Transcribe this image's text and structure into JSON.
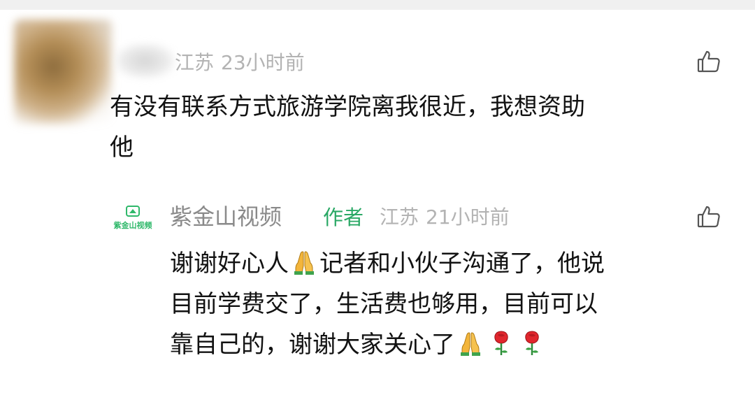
{
  "comment": {
    "location": "江苏",
    "time": "23小时前",
    "text_lines": [
      "有没有联系方式旅游学院离我很近，我想资助",
      "他"
    ]
  },
  "reply": {
    "avatar_text": "紫金山视频",
    "username": "紫金山视频",
    "badge": "作者",
    "location": "江苏",
    "time": "21小时前",
    "line1_before_emoji": "谢谢好心人",
    "line1_after_emoji": "记者和小伙子沟通了，他说",
    "line2": "目前学费交了，生活费也够用，目前可以",
    "line3": "靠自己的，谢谢大家关心了"
  },
  "icons": {
    "like": "thumbs-up-icon",
    "emoji_1": "folded-hands-icon",
    "emoji_2": "folded-hands-icon",
    "emoji_3": "rose-icon",
    "emoji_4": "rose-icon"
  },
  "colors": {
    "author_green": "#2aa865",
    "meta_gray": "#b3b3b3",
    "name_gray": "#8a8a8a"
  }
}
